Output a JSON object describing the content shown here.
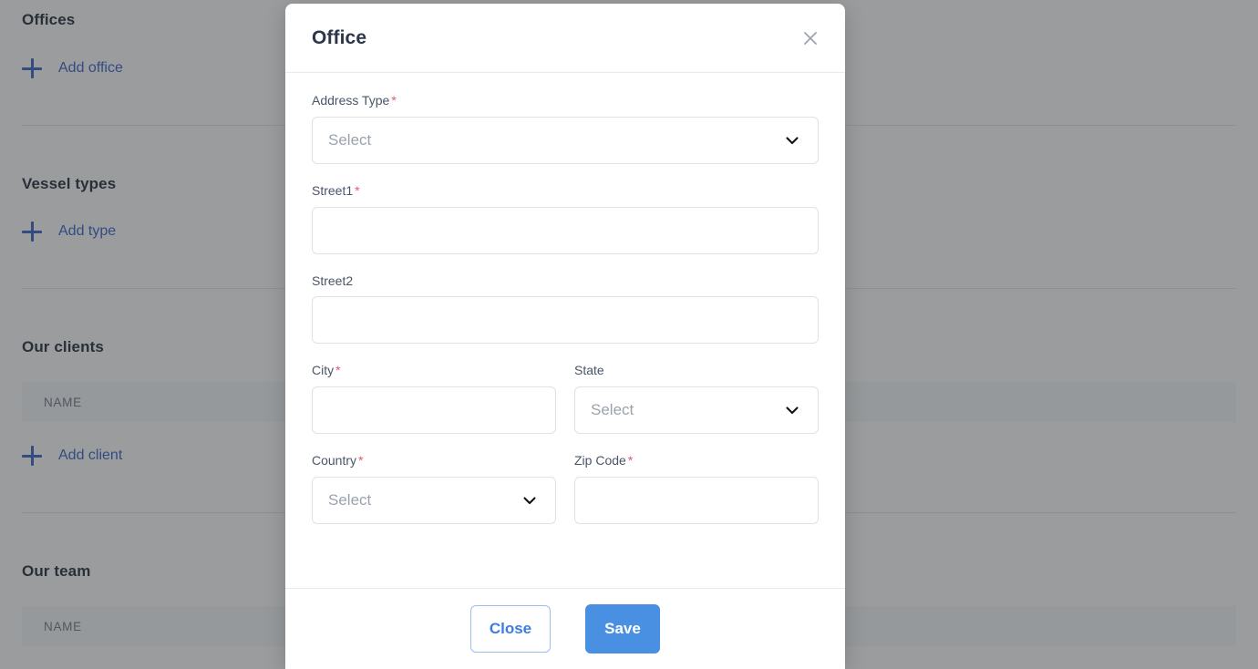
{
  "background": {
    "sections": [
      {
        "title": "Offices",
        "add_label": "Add office",
        "add_icon": "plus-icon",
        "has_table_header": false,
        "table_header": ""
      },
      {
        "title": "Vessel types",
        "add_label": "Add type",
        "add_icon": "plus-icon",
        "has_table_header": false,
        "table_header": ""
      },
      {
        "title": "Our clients",
        "add_label": "Add client",
        "add_icon": "plus-icon",
        "has_table_header": true,
        "table_header": "NAME"
      },
      {
        "title": "Our team",
        "add_label": "",
        "add_icon": "",
        "has_table_header": true,
        "table_header": "NAME"
      }
    ]
  },
  "modal": {
    "title": "Office",
    "close_icon": "close-icon",
    "fields": {
      "address_type": {
        "label": "Address Type",
        "required_marker": "*",
        "placeholder": "Select",
        "value": "",
        "type": "select",
        "chevron_icon": "chevron-down-icon"
      },
      "street1": {
        "label": "Street1",
        "required_marker": "*",
        "placeholder": "",
        "value": "",
        "type": "text"
      },
      "street2": {
        "label": "Street2",
        "required_marker": "",
        "placeholder": "",
        "value": "",
        "type": "text"
      },
      "city": {
        "label": "City",
        "required_marker": "*",
        "placeholder": "",
        "value": "",
        "type": "text"
      },
      "state": {
        "label": "State",
        "required_marker": "",
        "placeholder": "Select",
        "value": "",
        "type": "select",
        "chevron_icon": "chevron-down-icon"
      },
      "country": {
        "label": "Country",
        "required_marker": "*",
        "placeholder": "Select",
        "value": "",
        "type": "select",
        "chevron_icon": "chevron-down-icon"
      },
      "zip_code": {
        "label": "Zip Code",
        "required_marker": "*",
        "placeholder": "",
        "value": "",
        "type": "text"
      }
    },
    "footer": {
      "close_label": "Close",
      "save_label": "Save"
    }
  },
  "colors": {
    "primary_blue": "#4a90e2",
    "link_blue": "#2f5cc4",
    "required_red": "#e8556d",
    "title_navy": "#2b3648",
    "label_grey": "#4a5568",
    "placeholder_grey": "#9aa3ad",
    "border_grey": "#dde3ea",
    "overlay": "rgba(54,57,61,0.5)"
  }
}
